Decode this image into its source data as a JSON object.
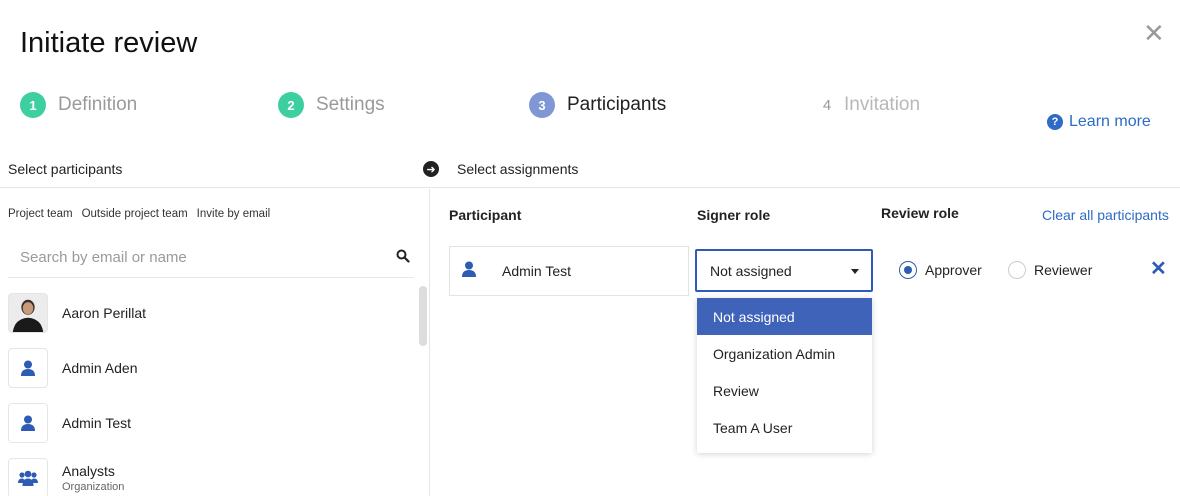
{
  "dialog": {
    "title": "Initiate review",
    "close_glyph": "✕"
  },
  "steps": [
    {
      "num": "1",
      "label": "Definition",
      "state": "done"
    },
    {
      "num": "2",
      "label": "Settings",
      "state": "done"
    },
    {
      "num": "3",
      "label": "Participants",
      "state": "active"
    },
    {
      "num": "4",
      "label": "Invitation",
      "state": "future"
    }
  ],
  "learn_more": {
    "label": "Learn more",
    "icon": "question-circle-icon"
  },
  "left": {
    "header": "Select participants",
    "tabs": [
      "Project team",
      "Outside project team",
      "Invite by email"
    ],
    "search_placeholder": "Search by email or name",
    "participants": [
      {
        "name": "Aaron Perillat",
        "sub": "",
        "avatar": "photo"
      },
      {
        "name": "Admin Aden",
        "sub": "",
        "avatar": "user-icon"
      },
      {
        "name": "Admin Test",
        "sub": "",
        "avatar": "user-icon"
      },
      {
        "name": "Analysts",
        "sub": "Organization",
        "avatar": "group-icon"
      }
    ]
  },
  "right": {
    "header": "Select assignments",
    "columns": {
      "participant": "Participant",
      "signer_role": "Signer role",
      "review_role": "Review role"
    },
    "clear_all": "Clear all participants",
    "row": {
      "name": "Admin Test",
      "signer_role_value": "Not assigned",
      "signer_role_options": [
        "Not assigned",
        "Organization Admin",
        "Review",
        "Team A User"
      ],
      "review_roles": [
        "Approver",
        "Reviewer"
      ],
      "selected_review_role": "Approver"
    }
  },
  "colors": {
    "accent": "#2e5bb3",
    "step_done": "#3ecfa0",
    "step_active": "#7f97d4",
    "link": "#2d6bc4"
  }
}
